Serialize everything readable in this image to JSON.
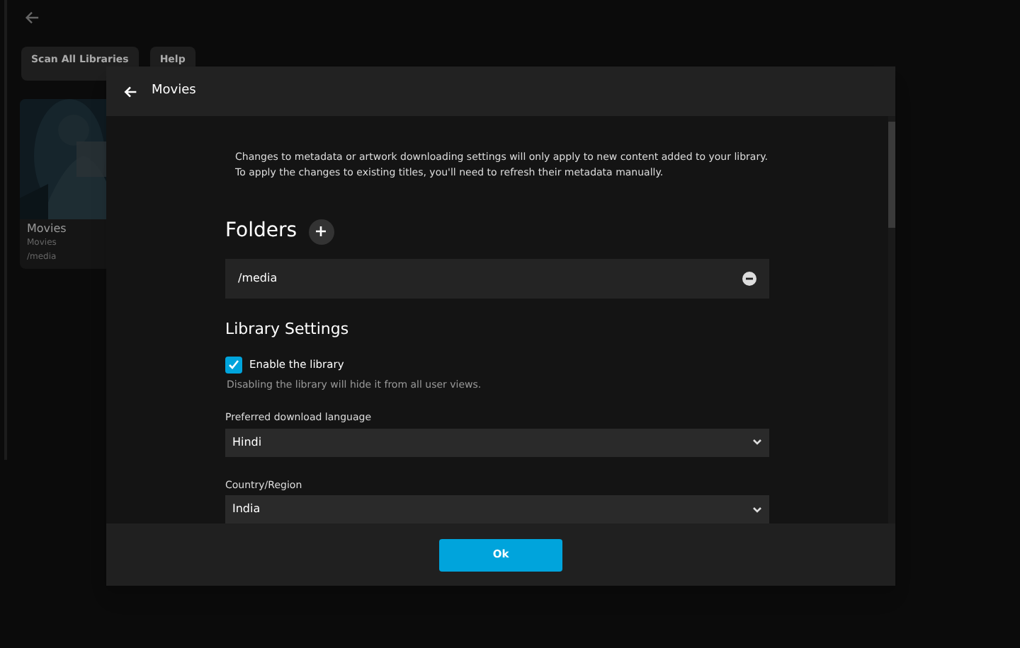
{
  "background": {
    "buttons": [
      "Scan All Libraries",
      "Help"
    ],
    "library_card": {
      "title": "Movies",
      "type": "Movies",
      "path": "/media"
    }
  },
  "dialog": {
    "title": "Movies",
    "notice": [
      "Changes to metadata or artwork downloading settings will only apply to new content added to your library.",
      "To apply the changes to existing titles, you'll need to refresh their metadata manually."
    ],
    "folders_heading": "Folders",
    "folders": [
      "/media"
    ],
    "library_settings_heading": "Library Settings",
    "enable_library": {
      "label": "Enable the library",
      "checked": true,
      "hint": "Disabling the library will hide it from all user views."
    },
    "selects": [
      {
        "label": "Preferred download language",
        "value": "Hindi"
      },
      {
        "label": "Country/Region",
        "value": "India"
      }
    ],
    "ok_button": "Ok"
  }
}
